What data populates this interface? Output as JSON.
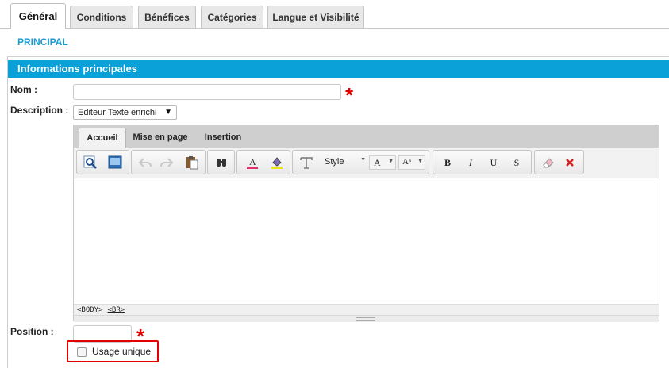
{
  "tabs": [
    {
      "label": "Général",
      "active": true
    },
    {
      "label": "Conditions",
      "active": false
    },
    {
      "label": "Bénéfices",
      "active": false
    },
    {
      "label": "Catégories",
      "active": false
    },
    {
      "label": "Langue et Visibilité",
      "active": false
    }
  ],
  "section_label": "PRINCIPAL",
  "panel_title": "Informations principales",
  "form": {
    "nom_label": "Nom :",
    "nom_value": "",
    "required_marker": "*",
    "description_label": "Description :",
    "description_select": "Editeur Texte enrichi",
    "position_label": "Position :",
    "position_value": "",
    "usage_unique_label": "Usage unique",
    "usage_unique_checked": false
  },
  "editor": {
    "tabs": [
      "Accueil",
      "Mise en page",
      "Insertion"
    ],
    "active_tab": "Accueil",
    "style_label": "Style",
    "font_size_label": "A",
    "font_size2_label": "Aᵃ",
    "status_path": [
      "<BODY>",
      "<BR>"
    ],
    "icons": [
      "preview-icon",
      "layout-icon",
      "undo-icon",
      "redo-icon",
      "paste-icon",
      "find-icon",
      "font-color-icon",
      "highlight-icon",
      "text-style-icon",
      "bold-icon",
      "italic-icon",
      "underline-icon",
      "strikethrough-icon",
      "eraser-icon",
      "remove-format-icon"
    ]
  },
  "colors": {
    "accent": "#0aa0d8",
    "required": "#e30000",
    "highlight_box": "#e30000"
  }
}
